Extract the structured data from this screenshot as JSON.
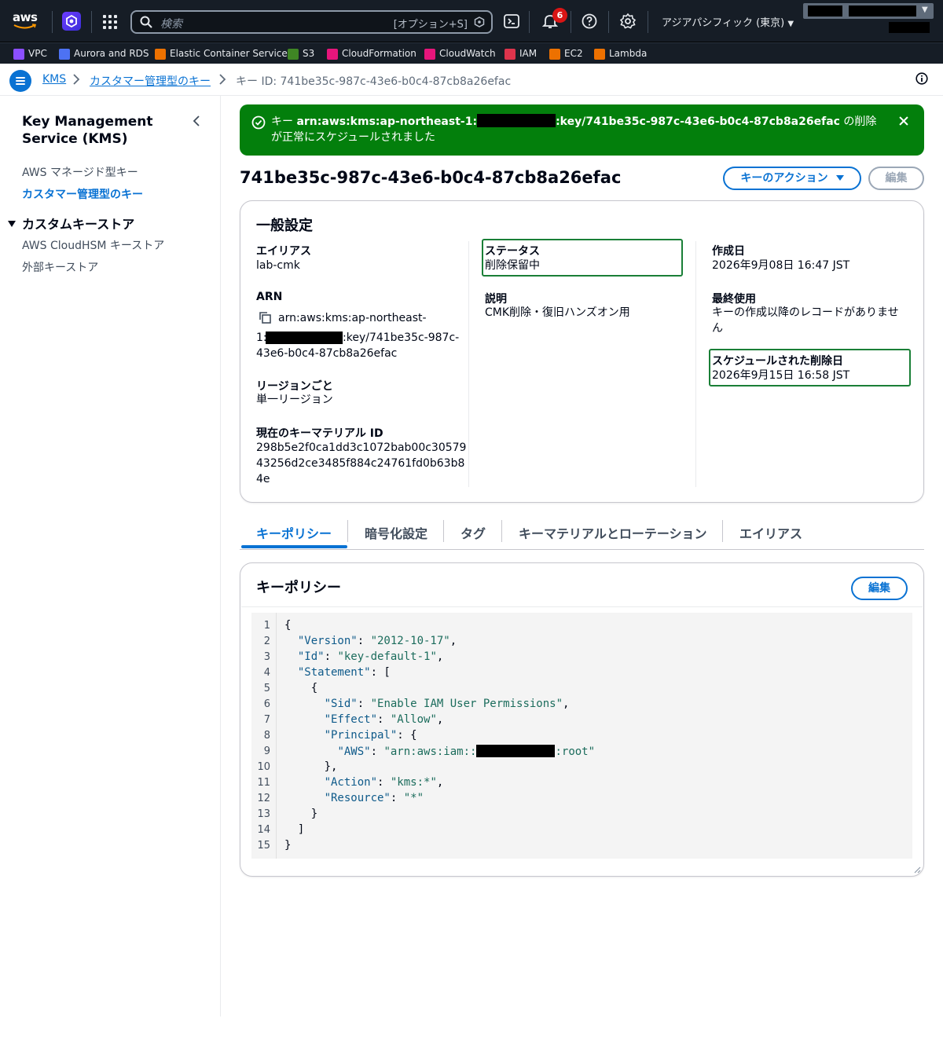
{
  "topnav": {
    "logo_text": "aws",
    "search_placeholder": "検索",
    "search_shortcut": "[オプション+S]",
    "notifications_count": "6",
    "region": "アジアパシフィック (東京)"
  },
  "favorites": [
    {
      "label": "VPC",
      "color": "#8c4fff"
    },
    {
      "label": "Aurora and RDS",
      "color": "#4d72f3"
    },
    {
      "label": "Elastic Container Service",
      "color": "#ed7100"
    },
    {
      "label": "S3",
      "color": "#3f8624"
    },
    {
      "label": "CloudFormation",
      "color": "#e7157b"
    },
    {
      "label": "CloudWatch",
      "color": "#e7157b"
    },
    {
      "label": "IAM",
      "color": "#dd344c"
    },
    {
      "label": "EC2",
      "color": "#ed7100"
    },
    {
      "label": "Lambda",
      "color": "#ed7100"
    }
  ],
  "breadcrumb": {
    "items": [
      "KMS",
      "カスタマー管理型のキー",
      "キー ID: 741be35c-987c-43e6-b0c4-87cb8a26efac"
    ]
  },
  "sidenav": {
    "title": "Key Management Service (KMS)",
    "items": [
      "AWS マネージド型キー",
      "カスタマー管理型のキー"
    ],
    "section": "カスタムキーストア",
    "section_items": [
      "AWS CloudHSM キーストア",
      "外部キーストア"
    ]
  },
  "flash": {
    "prefix": "キー ",
    "arn_start": "arn:aws:kms:ap-northeast-1:",
    "arn_end": ":key/741be35c-987c-43e6-b0c4-87cb8a26efac",
    "suffix": " の削除が正常にスケジュールされました",
    "color": "#037f0c"
  },
  "page": {
    "title": "741be35c-987c-43e6-b0c4-87cb8a26efac",
    "actions_label": "キーのアクション",
    "edit_label": "編集"
  },
  "general": {
    "heading": "一般設定",
    "alias_label": "エイリアス",
    "alias_value": "lab-cmk",
    "arn_label": "ARN",
    "arn_line1": "arn:aws:kms:ap-northeast-",
    "arn_line2_start": "1:",
    "arn_line2_end": ":key/741be35c-987c-",
    "arn_line3": "43e6-b0c4-87cb8a26efac",
    "region_label": "リージョンごと",
    "region_value": "単一リージョン",
    "material_label": "現在のキーマテリアル ID",
    "material_line1": "298b5e2f0ca1dd3c1072bab00c30579",
    "material_line2": "43256d2ce3485f884c24761fd0b63b8",
    "material_line3": "4e",
    "status_label": "ステータス",
    "status_value": "削除保留中",
    "desc_label": "説明",
    "desc_value": "CMK削除・復旧ハンズオン用",
    "created_label": "作成日",
    "created_value": "2026年9月08日 16:47 JST",
    "lastused_label": "最終使用",
    "lastused_line1": "キーの作成以降のレコードがありませ",
    "lastused_line2": "ん",
    "scheduled_label": "スケジュールされた削除日",
    "scheduled_value": "2026年9月15日 16:58 JST"
  },
  "tabs": [
    "キーポリシー",
    "暗号化設定",
    "タグ",
    "キーマテリアルとローテーション",
    "エイリアス"
  ],
  "policy": {
    "heading": "キーポリシー",
    "edit_label": "編集",
    "line_numbers": [
      "1",
      "2",
      "3",
      "4",
      "5",
      "6",
      "7",
      "8",
      "9",
      "10",
      "11",
      "12",
      "13",
      "14",
      "15"
    ],
    "code": {
      "l1": "{",
      "l2_key": "\"Version\"",
      "l2_val": "\"2012-10-17\"",
      "l3_key": "\"Id\"",
      "l3_val": "\"key-default-1\"",
      "l4_key": "\"Statement\"",
      "l4_rest": ": [",
      "l5": "{",
      "l6_key": "\"Sid\"",
      "l6_val": "\"Enable IAM User Permissions\"",
      "l7_key": "\"Effect\"",
      "l7_val": "\"Allow\"",
      "l8_key": "\"Principal\"",
      "l8_rest": ": {",
      "l9_key": "\"AWS\"",
      "l9_val_start": "\"arn:aws:iam::",
      "l9_val_end": ":root\"",
      "l10": "},",
      "l11_key": "\"Action\"",
      "l11_val": "\"kms:*\"",
      "l12_key": "\"Resource\"",
      "l12_val": "\"*\"",
      "l13": "}",
      "l14": "]",
      "l15": "}"
    }
  }
}
